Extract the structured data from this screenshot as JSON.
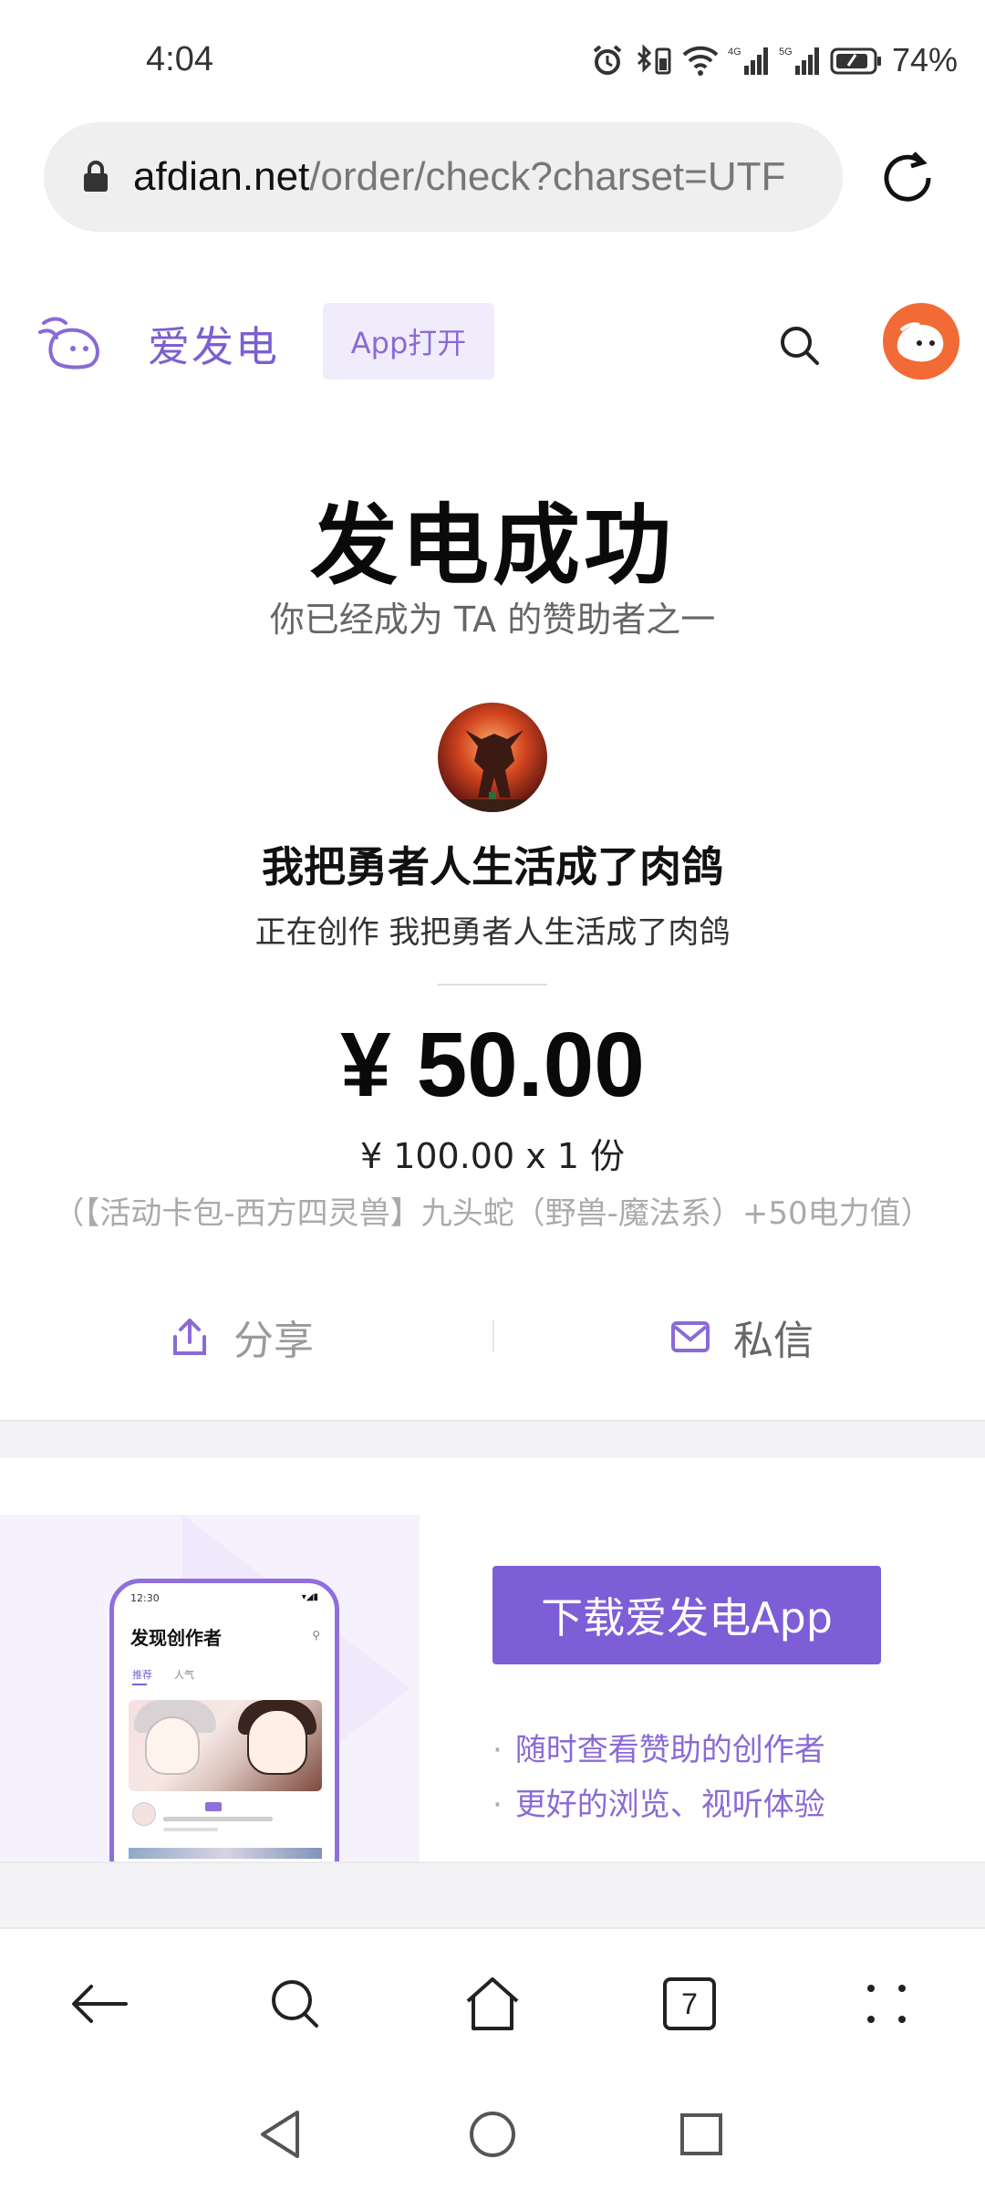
{
  "status_bar": {
    "time": "4:04",
    "battery": "74%",
    "net1": "4G",
    "net2": "5G"
  },
  "browser": {
    "url_domain": "afdian.net",
    "url_path": "/order/check?charset=UTF"
  },
  "site": {
    "brand": "爱发电",
    "app_open": "App打开"
  },
  "success": {
    "title": "发电成功",
    "subtitle": "你已经成为 TA 的赞助者之一"
  },
  "creator": {
    "name": "我把勇者人生活成了肉鸽",
    "desc": "正在创作 我把勇者人生活成了肉鸽"
  },
  "order": {
    "amount": "¥ 50.00",
    "unit_line": "¥ 100.00 x 1 份",
    "item": "（【活动卡包-西方四灵兽】九头蛇（野兽-魔法系）+50电力值）"
  },
  "actions": {
    "share": "分享",
    "message": "私信"
  },
  "promo": {
    "download": "下载爱发电App",
    "points": [
      "随时查看赞助的创作者",
      "更好的浏览、视听体验"
    ],
    "phone": {
      "time": "12:30",
      "title": "发现创作者",
      "tab_recommend": "推荐",
      "tab_popular": "人气"
    }
  },
  "toolbar": {
    "tab_count": "7"
  },
  "colors": {
    "brand_purple": "#7c5fd0",
    "button_purple": "#7d5ed6",
    "avatar_orange": "#f26a35"
  }
}
